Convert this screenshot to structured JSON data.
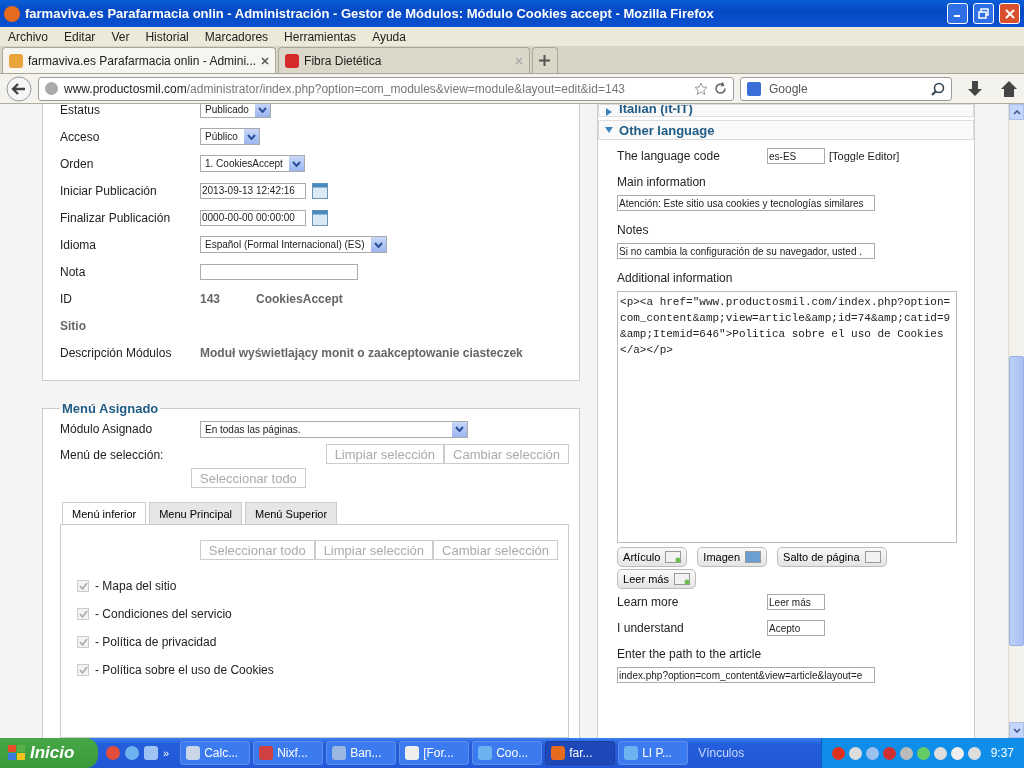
{
  "window": {
    "title": "farmaviva.es Parafarmacia onlin - Administración - Gestor de Módulos: Módulo Cookies accept - Mozilla Firefox"
  },
  "menu": [
    "Archivo",
    "Editar",
    "Ver",
    "Historial",
    "Marcadores",
    "Herramientas",
    "Ayuda"
  ],
  "tabs": [
    {
      "label": "farmaviva.es Parafarmacia onlin - Admini...",
      "selected": true
    },
    {
      "label": "Fibra Dietética",
      "selected": false
    }
  ],
  "nav": {
    "url_host": "www.productosmil.com",
    "url_path": "/administrator/index.php?option=com_modules&view=module&layout=edit&id=143",
    "search_placeholder": "Google"
  },
  "details": [
    {
      "label": "Estatus",
      "kind": "select",
      "value": "Publicado"
    },
    {
      "label": "Acceso",
      "kind": "select",
      "value": "Público"
    },
    {
      "label": "Orden",
      "kind": "select",
      "value": "1. CookiesAccept"
    },
    {
      "label": "Iniciar Publicación",
      "kind": "date",
      "value": "2013-09-13 12:42:16"
    },
    {
      "label": "Finalizar Publicación",
      "kind": "date",
      "value": "0000-00-00 00:00:00"
    },
    {
      "label": "Idioma",
      "kind": "select",
      "value": "Español (Formal Internacional) (ES)"
    },
    {
      "label": "Nota",
      "kind": "text"
    },
    {
      "label": "ID",
      "kind": "static",
      "value": "143",
      "extra": "CookiesAccept"
    },
    {
      "label": "Sitio",
      "kind": "heading"
    },
    {
      "label": "Descripción Módulos",
      "kind": "static",
      "value": "Moduł wyświetlający monit o zaakceptowanie ciasteczek"
    }
  ],
  "menu_assignment": {
    "legend": "Menú Asignado",
    "assigned_label": "Módulo Asignado",
    "assigned_value": "En todas las páginas.",
    "selection_label": "Menú de selección:",
    "buttons": [
      "Limpiar selección",
      "Cambiar selección",
      "Seleccionar todo"
    ],
    "tabs": [
      {
        "label": "Menú inferior",
        "selected": true
      },
      {
        "label": "Menu Principal",
        "selected": false
      },
      {
        "label": "Menú Superior",
        "selected": false
      }
    ],
    "tab_buttons": [
      "Seleccionar todo",
      "Limpiar selección",
      "Cambiar selección"
    ],
    "items": [
      {
        "label": "- Mapa del sitio",
        "checked": true
      },
      {
        "label": "- Condiciones del servicio",
        "checked": true
      },
      {
        "label": "- Política de privacidad",
        "checked": true
      },
      {
        "label": "- Política sobre el uso de Cookies",
        "checked": true
      }
    ]
  },
  "languages": [
    {
      "title": "Italian (it-IT)",
      "expanded": false
    },
    {
      "title": "Other language",
      "expanded": true
    }
  ],
  "other_language": {
    "code_label": "The language code",
    "code_value": "es-ES",
    "toggle": "[Toggle Editor]",
    "main_label": "Main information",
    "main_value": "Atención: Este sitio usa cookies y tecnologías similares",
    "notes_label": "Notes",
    "notes_value": "Si no cambia la configuración de su navegador, usted .",
    "additional_label": "Additional information",
    "additional_value": "<p><a href=\"www.productosmil.com/index.php?option=com_content&amp;view=article&amp;id=74&amp;catid=9&amp;Itemid=646\">Politica sobre el uso de Cookies</a></p>",
    "editor_buttons": [
      "Artículo",
      "Imagen",
      "Salto de página",
      "Leer más"
    ],
    "fields": [
      {
        "label": "Learn more",
        "value": "Leer más"
      },
      {
        "label": "I understand",
        "value": "Acepto"
      }
    ],
    "path_label": "Enter the path to the article",
    "path_value": "index.php?option=com_content&view=article&layout=e"
  },
  "taskbar": {
    "start": "Inicio",
    "items": [
      {
        "label": "Calc...",
        "selected": false
      },
      {
        "label": "Nixf...",
        "selected": false
      },
      {
        "label": "Ban...",
        "selected": false
      },
      {
        "label": "[For...",
        "selected": false
      },
      {
        "label": "Coo...",
        "selected": false
      },
      {
        "label": "far...",
        "selected": true
      },
      {
        "label": "LI P...",
        "selected": false
      }
    ],
    "links": "Vínculos",
    "more": "»",
    "clock": "9:37"
  }
}
